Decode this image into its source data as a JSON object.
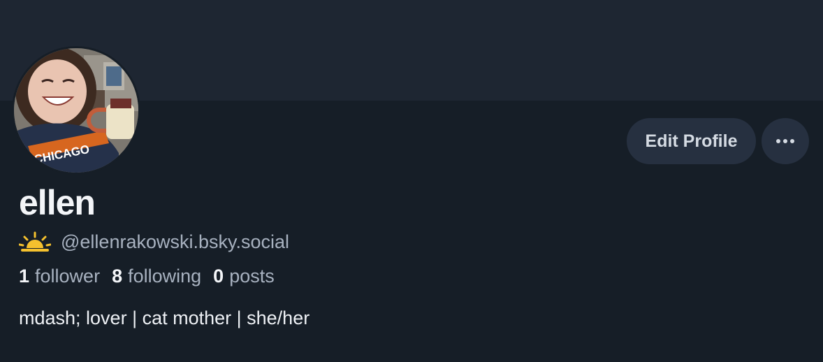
{
  "profile": {
    "display_name": "ellen",
    "handle": "@ellenrakowski.bsky.social",
    "handle_icon": "sunrise-emoji-icon",
    "bio": "mdash; lover | cat mother | she/her",
    "avatar_text": "CHICAGO"
  },
  "stats": {
    "followers_count": "1",
    "followers_label": "follower",
    "following_count": "8",
    "following_label": "following",
    "posts_count": "0",
    "posts_label": "posts"
  },
  "actions": {
    "edit_profile_label": "Edit Profile",
    "more_icon": "ellipsis-icon"
  },
  "colors": {
    "background": "#161e27",
    "banner": "#1e2632",
    "button_bg": "#263040",
    "muted_text": "#a8b2c0",
    "primary_text": "#f3f5f8",
    "sun_emoji": "#f5c12e"
  }
}
